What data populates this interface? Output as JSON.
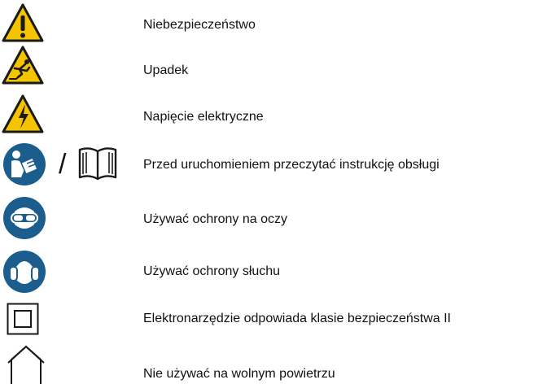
{
  "colors": {
    "warning_yellow": "#F5C400",
    "mandatory_blue": "#1B5E8E",
    "outline": "#1a1a1a"
  },
  "symbols": [
    {
      "icon": "warning-exclamation-icon",
      "label": "Niebezpieczeństwo"
    },
    {
      "icon": "warning-falling-icon",
      "label": "Upadek"
    },
    {
      "icon": "warning-electric-icon",
      "label": "Napięcie elektryczne"
    },
    {
      "icon": "read-manual-icon",
      "separator": "/",
      "icon_alt": "open-book-icon",
      "label": "Przed uruchomieniem przeczytać instrukcję obsługi"
    },
    {
      "icon": "eye-protection-icon",
      "label": "Używać ochrony na oczy"
    },
    {
      "icon": "ear-protection-icon",
      "label": "Używać ochrony słuchu"
    },
    {
      "icon": "protection-class-ii-icon",
      "label": "Elektronarzędzie odpowiada klasie bezpieczeństwa II"
    },
    {
      "icon": "indoor-use-only-icon",
      "label": "Nie używać na wolnym powietrzu"
    }
  ]
}
